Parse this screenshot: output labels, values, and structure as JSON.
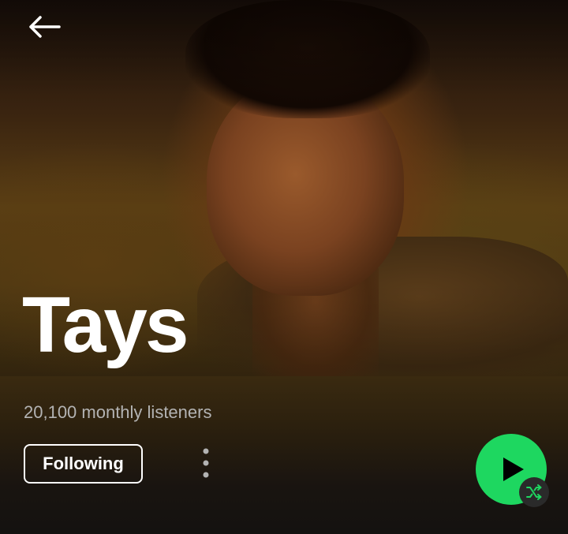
{
  "artist": {
    "name": "Tays",
    "monthly_listeners": "20,100 monthly listeners"
  },
  "actions": {
    "follow_label": "Following"
  },
  "icons": {
    "back": "arrow-left-icon",
    "more": "more-vertical-icon",
    "play": "play-icon",
    "shuffle": "shuffle-icon"
  },
  "colors": {
    "accent": "#1ed760",
    "background": "#121212",
    "secondary_text": "#b3b3b3"
  }
}
